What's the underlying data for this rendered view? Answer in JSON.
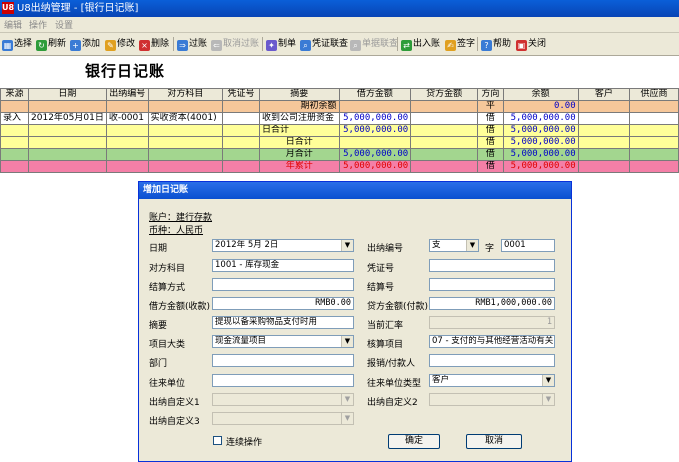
{
  "window": {
    "logo": "U8",
    "title": "U8出纳管理 - [银行日记账]"
  },
  "menu": [
    "编辑",
    "操作",
    "设置"
  ],
  "toolbar": [
    {
      "label": "选择",
      "icon": "select-icon",
      "color": "#3a7bd5",
      "glyph": "▦",
      "enabled": true
    },
    {
      "label": "刷新",
      "icon": "refresh-icon",
      "color": "#2e9c3a",
      "glyph": "↻",
      "enabled": true
    },
    {
      "label": "添加",
      "icon": "add-icon",
      "color": "#3a7bd5",
      "glyph": "+",
      "enabled": true
    },
    {
      "label": "修改",
      "icon": "edit-icon",
      "color": "#e0a020",
      "glyph": "✎",
      "enabled": true
    },
    {
      "label": "删除",
      "icon": "delete-icon",
      "color": "#d03030",
      "glyph": "×",
      "enabled": true
    },
    {
      "label": "过账",
      "icon": "post-icon",
      "color": "#3a7bd5",
      "glyph": "⇒",
      "enabled": true
    },
    {
      "label": "取消过账",
      "icon": "unpost-icon",
      "color": "#b8b8b8",
      "glyph": "⇐",
      "enabled": false
    },
    {
      "label": "制单",
      "icon": "voucher-icon",
      "color": "#6a5acd",
      "glyph": "✦",
      "enabled": true
    },
    {
      "label": "凭证联查",
      "icon": "voucher-query-icon",
      "color": "#3a7bd5",
      "glyph": "⌕",
      "enabled": true
    },
    {
      "label": "单据联查",
      "icon": "bill-query-icon",
      "color": "#b8b8b8",
      "glyph": "⌕",
      "enabled": false
    },
    {
      "label": "出入账",
      "icon": "in-out-icon",
      "color": "#2e9c3a",
      "glyph": "⇄",
      "enabled": true
    },
    {
      "label": "签字",
      "icon": "sign-icon",
      "color": "#e0a020",
      "glyph": "✍",
      "enabled": true
    },
    {
      "label": "帮助",
      "icon": "help-icon",
      "color": "#3a7bd5",
      "glyph": "?",
      "enabled": true
    },
    {
      "label": "关闭",
      "icon": "close-icon",
      "color": "#d03030",
      "glyph": "▣",
      "enabled": true
    }
  ],
  "doc_title": "银行日记账",
  "grid": {
    "headers": [
      "来源",
      "日期",
      "出纳编号",
      "对方科目",
      "凭证号",
      "摘要",
      "借方金额",
      "贷方金额",
      "方向",
      "余额",
      "客户",
      "供应商"
    ],
    "rows": [
      {
        "type": "open",
        "cells": [
          "",
          "",
          "",
          "",
          "",
          "期初余额",
          "",
          "",
          "平",
          "0.00",
          "",
          ""
        ]
      },
      {
        "type": "entry",
        "cells": [
          "录入",
          "2012年05月01日",
          "收-0001",
          "实收资本(4001)",
          "",
          "收到公司注册资金",
          "5,000,000.00",
          "",
          "借",
          "5,000,000.00",
          "",
          ""
        ]
      },
      {
        "type": "day",
        "cells": [
          "",
          "",
          "",
          "",
          "",
          "日合计",
          "5,000,000.00",
          "",
          "借",
          "5,000,000.00",
          "",
          ""
        ]
      },
      {
        "type": "day",
        "cells": [
          "",
          "",
          "",
          "",
          "",
          "日合计",
          "",
          "",
          "借",
          "5,000,000.00",
          "",
          ""
        ]
      },
      {
        "type": "month",
        "cells": [
          "",
          "",
          "",
          "",
          "",
          "月合计",
          "5,000,000.00",
          "",
          "借",
          "5,000,000.00",
          "",
          ""
        ]
      },
      {
        "type": "year",
        "cells": [
          "",
          "",
          "",
          "",
          "",
          "年累计",
          "5,000,000.00",
          "",
          "借",
          "5,000,000.00",
          "",
          ""
        ]
      }
    ]
  },
  "dialog": {
    "title": "增加日记账",
    "account": "账户：建行存款",
    "currency": "币种：人民币",
    "fields": {
      "date_label": "日期",
      "date_value": "2012年 5月 2日",
      "cashier_no_label": "出纳编号",
      "cashier_no_type": "支",
      "cashier_no_char": "字",
      "cashier_no_value": "0001",
      "counter_account_label": "对方科目",
      "counter_account_value": "1001 - 库存现金",
      "voucher_no_label": "凭证号",
      "voucher_no_value": "",
      "settle_method_label": "结算方式",
      "settle_method_value": "",
      "settle_no_label": "结算号",
      "settle_no_value": "",
      "debit_label": "借方金额(收款)",
      "debit_value": "RMB0.00",
      "credit_label": "贷方金额(付款)",
      "credit_value": "RMB1,000,000.00",
      "summary_label": "摘要",
      "summary_value": "提现以备采购物品支付时用",
      "rate_label": "当前汇率",
      "rate_value": "1",
      "project_class_label": "项目大类",
      "project_class_value": "现金流量项目",
      "project_label": "核算项目",
      "project_value": "07 - 支付的与其他经营活动有关",
      "dept_label": "部门",
      "dept_value": "",
      "handler_label": "报销/付款人",
      "handler_value": "",
      "unit_label": "往来单位",
      "unit_value": "",
      "unit_type_label": "往来单位类型",
      "unit_type_value": "客户",
      "custom1_label": "出纳自定义1",
      "custom2_label": "出纳自定义2",
      "custom3_label": "出纳自定义3"
    },
    "continue_label": "连续操作",
    "ok_label": "确定",
    "cancel_label": "取消"
  }
}
